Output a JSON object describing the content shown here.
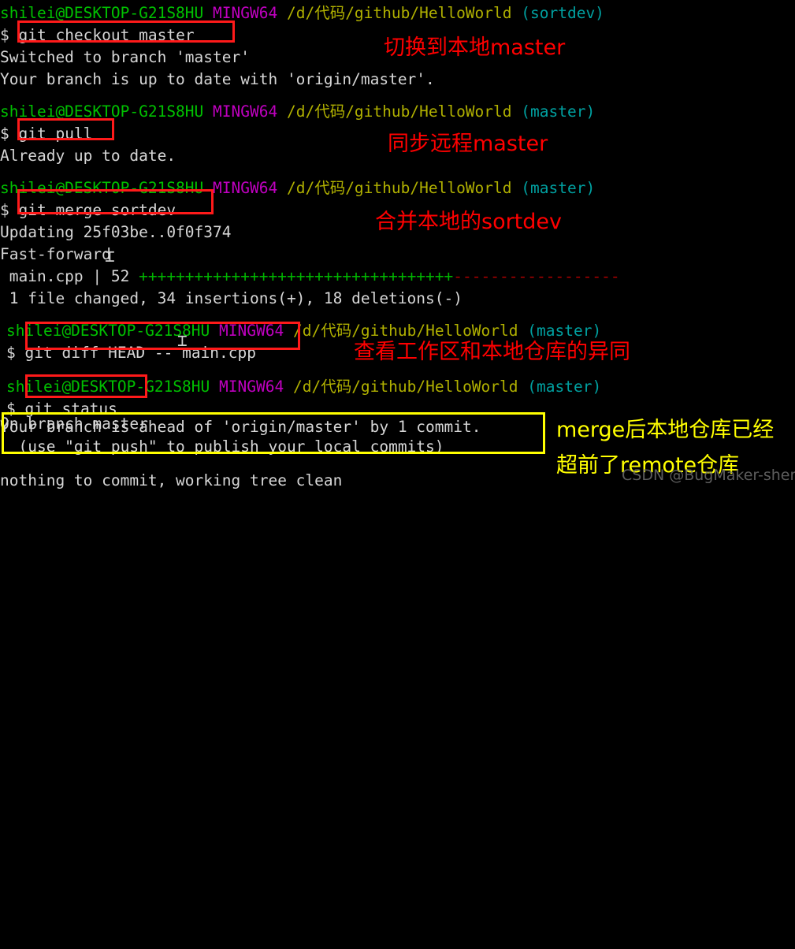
{
  "terminal": {
    "prompt": {
      "user_host": "shilei@DESKTOP-G21S8HU",
      "shell": "MINGW64",
      "path": "/d/代码/github/HelloWorld",
      "dollar": "$"
    },
    "branches": {
      "sortdev": "(sortdev)",
      "master": "(master)"
    },
    "blocks": [
      {
        "command": "git checkout master",
        "output": [
          "Switched to branch 'master'",
          "Your branch is up to date with 'origin/master'."
        ]
      },
      {
        "command": "git pull",
        "output": [
          "Already up to date."
        ]
      },
      {
        "command": "git merge sortdev",
        "output": [
          "Updating 25f03be..0f0f374",
          "Fast-forward",
          " main.cpp | 52 ",
          " 1 file changed, 34 insertions(+), 18 deletions(-)"
        ]
      },
      {
        "command": "git diff HEAD -- main.cpp",
        "output": []
      },
      {
        "command": "git status",
        "output": [
          "On branch master",
          "Your branch is ahead of 'origin/master' by 1 commit.",
          "  (use \"git push\" to publish your local commits)",
          "",
          "nothing to commit, working tree clean"
        ]
      }
    ],
    "diffstat": {
      "file": " main.cpp | 52 ",
      "plus_marks": "++++++++++++++++++++++++++++++++++",
      "minus_marks": "------------------",
      "insertions": 34,
      "deletions": 18
    }
  },
  "annotations": [
    {
      "id": "anno-checkout",
      "text": "切换到本地master",
      "color": "#ff0000"
    },
    {
      "id": "anno-pull",
      "text": "同步远程master",
      "color": "#ff0000"
    },
    {
      "id": "anno-merge",
      "text": "合并本地的sortdev",
      "color": "#ff0000"
    },
    {
      "id": "anno-diff",
      "text": "查看工作区和本地仓库的异同",
      "color": "#ff0000"
    },
    {
      "id": "anno-status-1",
      "text": "merge后本地仓库已经",
      "color": "#ffff00"
    },
    {
      "id": "anno-status-2",
      "text": "超前了remote仓库",
      "color": "#ffff00"
    }
  ],
  "highlight_colors": {
    "red_box": "#ff1a1a",
    "yellow_box": "#ffff00"
  },
  "watermark": "CSDN @BugMaker-shen"
}
